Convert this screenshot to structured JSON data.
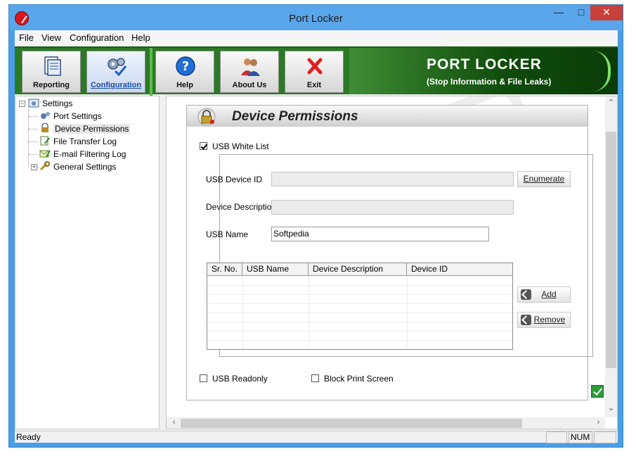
{
  "window": {
    "title": "Port Locker"
  },
  "menu": {
    "items": [
      "File",
      "View",
      "Configuration",
      "Help"
    ]
  },
  "toolbar": {
    "buttons": [
      {
        "label": "Reporting",
        "icon": "report-icon"
      },
      {
        "label": "Configuration",
        "icon": "gears-check-icon"
      },
      {
        "label": "Help",
        "icon": "help-icon"
      },
      {
        "label": "About Us",
        "icon": "users-icon"
      },
      {
        "label": "Exit",
        "icon": "red-x-icon"
      }
    ]
  },
  "brand": {
    "title": "PORT LOCKER",
    "subtitle": "(Stop Information & File Leaks)"
  },
  "tree": {
    "root": "Settings",
    "items": [
      "Port Settings",
      "Device Permissions",
      "File Transfer Log",
      "E-mail Filtering Log",
      "General Settings"
    ],
    "selected": "Device Permissions"
  },
  "panel": {
    "title": "Device Permissions",
    "usb_white_list": {
      "label": "USB White List",
      "checked": true
    },
    "fields": {
      "device_id_label": "USB Device ID",
      "device_id_value": "",
      "description_label": "Device Description",
      "description_value": "",
      "usb_name_label": "USB Name",
      "usb_name_value": "Softpedia"
    },
    "buttons": {
      "enumerate": "Enumerate",
      "add": "Add",
      "remove": "Remove"
    },
    "grid": {
      "columns": [
        "Sr. No.",
        "USB Name",
        "Device Description",
        "Device ID"
      ],
      "rows": []
    },
    "usb_readonly": {
      "label": "USB Readonly",
      "checked": false
    },
    "block_print_screen": {
      "label": "Block Print Screen",
      "checked": false
    }
  },
  "status": {
    "text": "Ready",
    "num": "NUM"
  },
  "colors": {
    "toolbar_green": "#2a7a24",
    "brand_dark": "#0e4a0a",
    "title_blue": "#5aa6ea",
    "close_red": "#c7403a"
  }
}
